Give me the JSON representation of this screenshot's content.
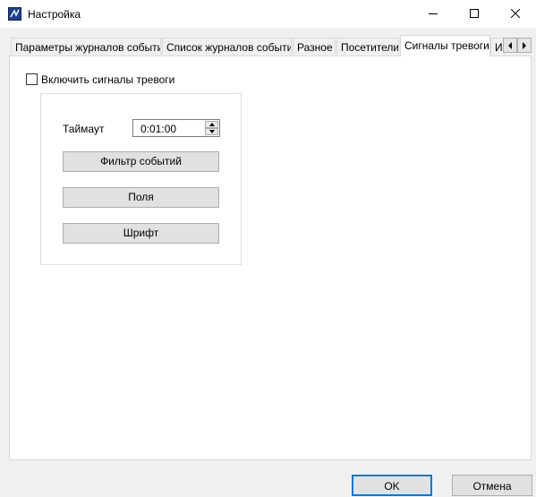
{
  "window": {
    "title": "Настройка",
    "minimize_label": "",
    "maximize_label": "",
    "close_label": ""
  },
  "tabs": [
    {
      "label": "Параметры журналов событий",
      "active": false
    },
    {
      "label": "Список журналов событий",
      "active": false
    },
    {
      "label": "Разное",
      "active": false
    },
    {
      "label": "Посетители",
      "active": false
    },
    {
      "label": "Сигналы тревоги",
      "active": true
    },
    {
      "label": "И",
      "active": false
    }
  ],
  "tab_scroll": {
    "left_icon": "chevron-left-icon",
    "right_icon": "chevron-right-icon"
  },
  "alarms": {
    "enable_label": "Включить сигналы тревоги",
    "enable_checked": false,
    "timeout_label": "Таймаут",
    "timeout_value": "0:01:00",
    "filter_button": "Фильтр событий",
    "fields_button": "Поля",
    "font_button": "Шрифт"
  },
  "dialog": {
    "ok_label": "OK",
    "cancel_label": "Отмена"
  },
  "colors": {
    "accent": "#0078d7",
    "button_face": "#e1e1e1",
    "window_bg": "#f0f0f0"
  }
}
